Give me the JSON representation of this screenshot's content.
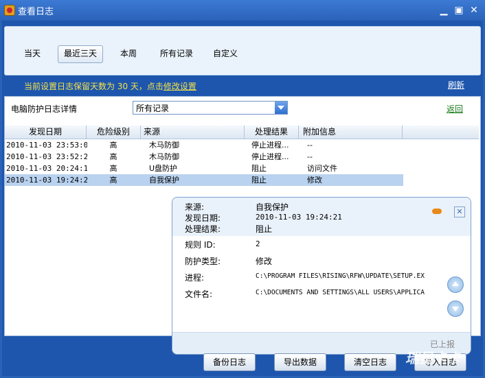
{
  "window": {
    "title": "查看日志"
  },
  "filters": [
    {
      "label": "当天"
    },
    {
      "label": "最近三天"
    },
    {
      "label": "本周"
    },
    {
      "label": "所有记录"
    },
    {
      "label": "自定义"
    }
  ],
  "notice": {
    "prefix": "当前设置日志保留天数为 30 天，点击",
    "link": "修改设置"
  },
  "refresh_label": "刷新",
  "detail": {
    "label": "电脑防护日志详情",
    "select_value": "所有记录",
    "back_label": "返回"
  },
  "table": {
    "columns": [
      "发现日期",
      "危险级别",
      "来源",
      "处理结果",
      "附加信息"
    ],
    "rows": [
      {
        "date": "2010-11-03 23:53:01",
        "level": "高",
        "source": "木马防御",
        "result": "停止进程...",
        "info": "--"
      },
      {
        "date": "2010-11-03 23:52:27",
        "level": "高",
        "source": "木马防御",
        "result": "停止进程...",
        "info": "--"
      },
      {
        "date": "2010-11-03 20:24:12",
        "level": "高",
        "source": "U盘防护",
        "result": "阻止",
        "info": "访问文件"
      },
      {
        "date": "2010-11-03 19:24:21",
        "level": "高",
        "source": "自我保护",
        "result": "阻止",
        "info": "修改"
      }
    ]
  },
  "popup": {
    "source_label": "来源:",
    "source_value": "自我保护",
    "date_label": "发现日期:",
    "date_value": "2010-11-03 19:24:21",
    "result_label": "处理结果:",
    "result_value": "阻止",
    "rule_label": "规则 ID:",
    "rule_value": "2",
    "type_label": "防护类型:",
    "type_value": "修改",
    "process_label": "进程:",
    "process_value": "C:\\PROGRAM FILES\\RISING\\RFW\\UPDATE\\SETUP.EX",
    "file_label": "文件名:",
    "file_value": "C:\\DOCUMENTS AND SETTINGS\\ALL USERS\\APPLICA",
    "reported": "已上报"
  },
  "buttons": {
    "backup": "备份日志",
    "export": "导出数据",
    "clear": "清空日志",
    "import": "导入日志"
  },
  "watermark": "瑞星卡卡"
}
